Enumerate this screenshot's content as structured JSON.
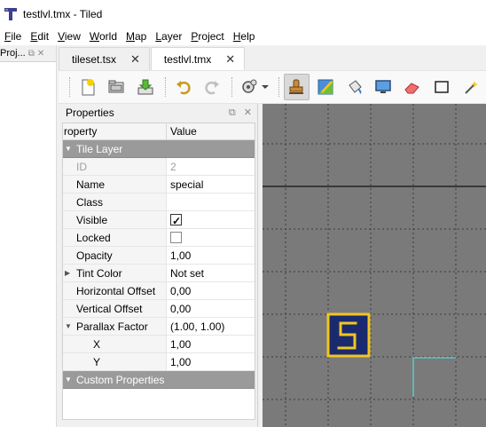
{
  "window": {
    "title": "testlvl.tmx - Tiled"
  },
  "menu": [
    {
      "label": "File",
      "key": "F",
      "rest": "ile"
    },
    {
      "label": "Edit",
      "key": "E",
      "rest": "dit"
    },
    {
      "label": "View",
      "key": "V",
      "rest": "iew"
    },
    {
      "label": "World",
      "key": "W",
      "rest": "orld"
    },
    {
      "label": "Map",
      "key": "M",
      "rest": "ap"
    },
    {
      "label": "Layer",
      "key": "L",
      "rest": "ayer"
    },
    {
      "label": "Project",
      "key": "P",
      "rest": "roject"
    },
    {
      "label": "Help",
      "key": "H",
      "rest": "elp"
    }
  ],
  "left_dock": {
    "title": "Proj..."
  },
  "tabs": [
    {
      "label": "tileset.tsx",
      "active": false
    },
    {
      "label": "testlvl.tmx",
      "active": true
    }
  ],
  "properties": {
    "title": "Properties",
    "col_property": "roperty",
    "col_value": "Value",
    "rows": {
      "tile_layer": "Tile Layer",
      "id_label": "ID",
      "id_value": "2",
      "name_label": "Name",
      "name_value": "special",
      "class_label": "Class",
      "class_value": "",
      "visible_label": "Visible",
      "visible_checked": true,
      "locked_label": "Locked",
      "locked_checked": false,
      "opacity_label": "Opacity",
      "opacity_value": "1,00",
      "tint_label": "Tint Color",
      "tint_value": "Not set",
      "hoff_label": "Horizontal Offset",
      "hoff_value": "0,00",
      "voff_label": "Vertical Offset",
      "voff_value": "0,00",
      "parallax_label": "Parallax Factor",
      "parallax_value": "(1.00, 1.00)",
      "x_label": "X",
      "x_value": "1,00",
      "y_label": "Y",
      "y_value": "1,00",
      "custom": "Custom Properties"
    }
  },
  "colors": {
    "map_bg": "#7a7a7a",
    "grid": "#3a3a3a",
    "tile_bg": "#1a2a6e",
    "tile_border": "#f2c522",
    "group_row": "#9a9a9a"
  }
}
